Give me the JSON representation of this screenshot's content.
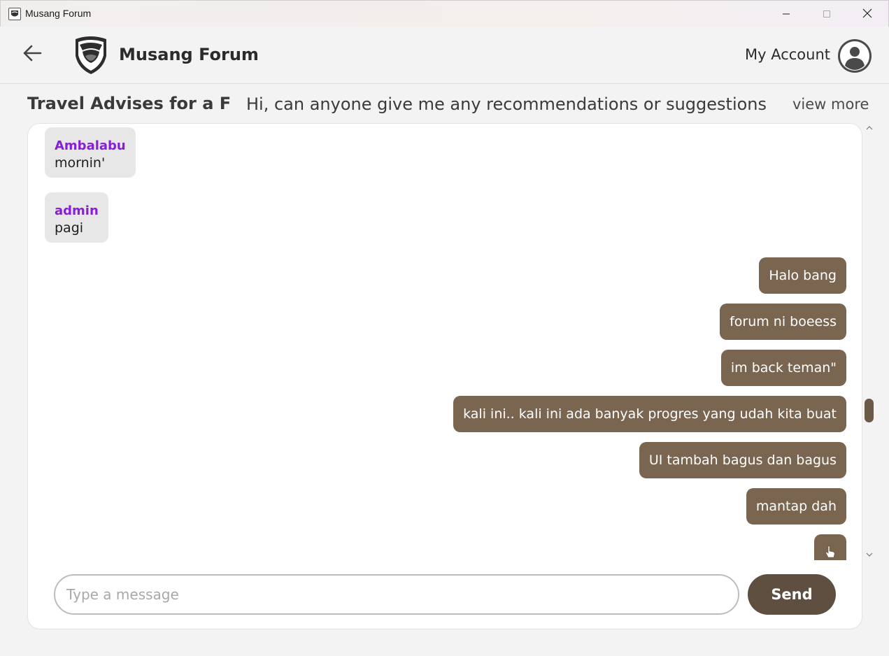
{
  "window": {
    "title": "Musang Forum",
    "icons": {
      "app": "musang-logo-icon",
      "minimize": "minimize-icon",
      "maximize": "maximize-icon",
      "close": "close-icon"
    }
  },
  "header": {
    "back_icon": "arrow-left-icon",
    "app_name": "Musang Forum",
    "account_label": "My Account",
    "avatar_icon": "user-avatar-icon"
  },
  "thread": {
    "title": "Travel Advises for a Fa...",
    "preview": "Hi, can anyone give me any recommendations or suggestions f...",
    "view_more": "view more"
  },
  "messages": {
    "incoming": [
      {
        "sender": "Ambalabu",
        "text": "mornin'"
      },
      {
        "sender": "admin",
        "text": "pagi"
      }
    ],
    "outgoing": [
      {
        "text": "Halo bang"
      },
      {
        "text": "forum ni boeess"
      },
      {
        "text": "im back teman\""
      },
      {
        "text": "kali ini.. kali ini ada banyak progres yang udah kita buat"
      },
      {
        "text": "UI tambah bagus dan bagus"
      },
      {
        "text": "mantap dah"
      }
    ],
    "partial_icon": "pointing-hand-icon"
  },
  "composer": {
    "placeholder": "Type a message",
    "value": "",
    "send_label": "Send"
  },
  "colors": {
    "outgoing_bubble": "#7a6650",
    "incoming_bubble": "#e7e7e7",
    "sender_name": "#8a1dd6",
    "send_button": "#5e4f40"
  }
}
